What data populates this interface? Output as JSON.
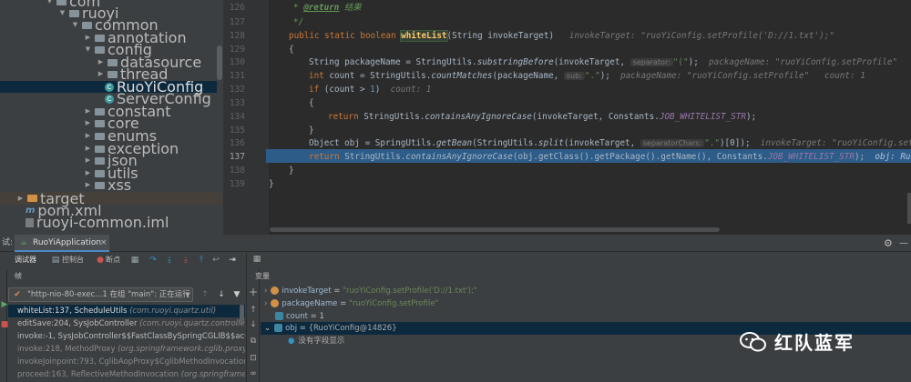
{
  "tree": {
    "com": "com",
    "ruoyi": "ruoyi",
    "common": "common",
    "annotation": "annotation",
    "config": "config",
    "datasource": "datasource",
    "thread": "thread",
    "ruoyiconfig": "RuoYiConfig",
    "serverconfig": "ServerConfig",
    "constant": "constant",
    "core": "core",
    "enums": "enums",
    "exception": "exception",
    "json": "json",
    "utils": "utils",
    "xss": "xss",
    "target": "target",
    "pom": "pom.xml",
    "iml": "ruoyi-common.iml"
  },
  "gutter": {
    "lines": [
      "126",
      "127",
      "128",
      "129",
      "130",
      "131",
      "132",
      "133",
      "134",
      "135",
      "136",
      "137",
      "138",
      "139"
    ],
    "current": "137"
  },
  "code": {
    "l126_star": "* ",
    "l126_tag": "@return",
    "l126_rest": " 结果",
    "l127": "*/",
    "l128_kw": "public static boolean ",
    "l128_name": "whiteList",
    "l128_args": "(String invokeTarget)",
    "l128_hint": "invokeTarget: \"ruoYiConfig.setProfile('D://1.txt');\"",
    "l129": "{",
    "l130_a": "String packageName = StringUtils.",
    "l130_m": "substringBefore",
    "l130_b": "(invokeTarget, ",
    "l130_p": "separator:",
    "l130_s": "\"(\"",
    "l130_c": ");",
    "l130_hint": "packageName: \"ruoYiConfig.setProfile\"",
    "l131_kw": "int ",
    "l131_a": "count = StringUtils.",
    "l131_m": "countMatches",
    "l131_b": "(packageName, ",
    "l131_p": "sub:",
    "l131_s": "\".\"",
    "l131_c": ");",
    "l131_hint": "packageName: \"ruoYiConfig.setProfile\"",
    "l131_hint2": "count: 1",
    "l132_kw": "if ",
    "l132_a": "(count > ",
    "l132_n": "1",
    "l132_b": ")",
    "l132_hint": "count: 1",
    "l133": "{",
    "l134_kw": "return ",
    "l134_a": "StringUtils.",
    "l134_m": "containsAnyIgnoreCase",
    "l134_b": "(invokeTarget, Constants.",
    "l134_f": "JOB_WHITELIST_STR",
    "l134_c": ");",
    "l135": "}",
    "l136_a": "Object obj = SpringUtils.",
    "l136_m": "getBean",
    "l136_b": "(StringUtils.",
    "l136_m2": "split",
    "l136_c": "(invokeTarget, ",
    "l136_p": "separatorChars:",
    "l136_s": "\".\"",
    "l136_d": ")[0]);",
    "l136_hint": "invokeTarget: \"ruoYiConfig.setPro",
    "l137_kw": "return ",
    "l137_a": "StringUtils.",
    "l137_m": "containsAnyIgnoreCase",
    "l137_b": "(obj.getClass().getPackage().getName(), Constants.",
    "l137_f": "JOB_WHITELIST_STR",
    "l137_c": ");",
    "l137_hint": "obj: RuoYiConfi",
    "l138": "}",
    "l139": "}"
  },
  "debug": {
    "label": "试:",
    "tab": "RuoYiApplication",
    "tab_close": "×",
    "debugger": "调试器",
    "console": "控制台",
    "breakpoints": "断点",
    "frames_label": "帧",
    "vars_label": "变量",
    "thread": "\"http-nio-80-exec...1 在组 \"main\": 正在运行",
    "frames": [
      {
        "main": "whiteList:137, ScheduleUtils ",
        "pkg": "(com.ruoyi.quartz.util)"
      },
      {
        "main": "editSave:204, SysJobController ",
        "pkg": "(com.ruoyi.quartz.controller)"
      },
      {
        "main": "invoke:-1, SysJobController$$FastClassBySpringCGLIB$$ac6b5b",
        "pkg": ""
      },
      {
        "main": "invoke:218, MethodProxy ",
        "pkg": "(org.springframework.cglib.proxy)"
      },
      {
        "main": "invokeJoinpoint:793, CglibAopProxy$CglibMethodInvocation ",
        "pkg": "(o"
      },
      {
        "main": "proceed:163, ReflectiveMethodInvocation ",
        "pkg": "(org.springframewo"
      }
    ],
    "vars": [
      {
        "name": "invokeTarget",
        "eq": " = ",
        "val": "\"ruoYiConfig.setProfile('D://1.txt');\""
      },
      {
        "name": "packageName",
        "eq": " = ",
        "val": "\"ruoYiConfig.setProfile\""
      },
      {
        "name": "count",
        "eq": " = ",
        "val": "1"
      },
      {
        "name": "obj",
        "eq": " = ",
        "val": "{RuoYiConfig@14826}"
      }
    ],
    "no_fields": "没有字段显示"
  },
  "watermark": {
    "text": "红队蓝军"
  },
  "colors": {
    "selection": "#2d5c88",
    "keyword": "#cc7832",
    "string": "#6a8759",
    "method_highlight": "#ffc66d"
  }
}
